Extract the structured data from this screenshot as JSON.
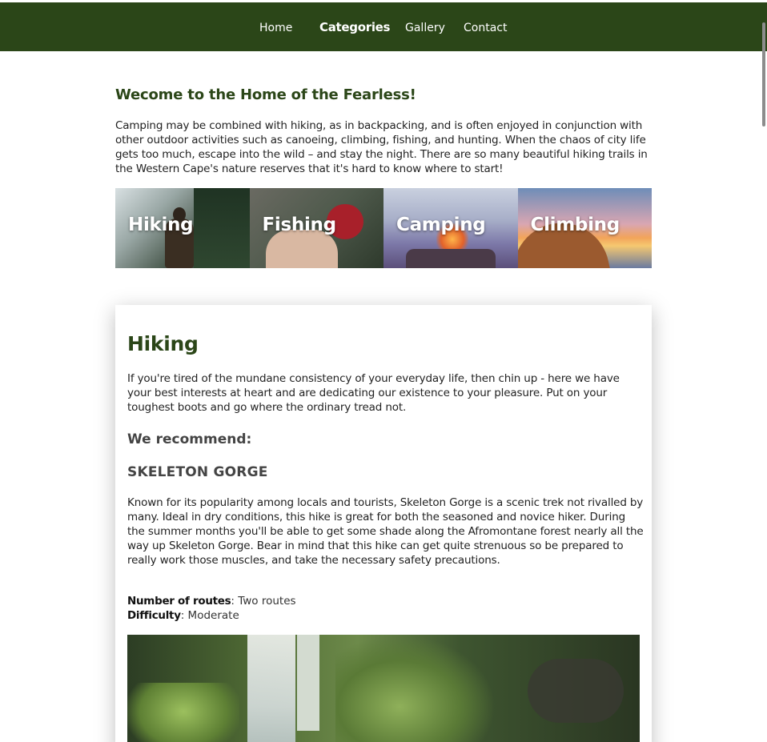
{
  "nav": {
    "items": [
      {
        "label": "Home"
      },
      {
        "label": "Categories"
      },
      {
        "label": "Gallery"
      },
      {
        "label": "Contact"
      }
    ],
    "active": "Categories"
  },
  "welcome": {
    "title": "Wecome to the Home of the Fearless!",
    "text": "Camping may be combined with hiking, as in backpacking, and is often enjoyed in conjunction with other outdoor activities such as canoeing, climbing, fishing, and hunting. When the chaos of city life gets too much, escape into the wild – and stay the night. There are so many beautiful hiking trails in the Western Cape's nature reserves that it's hard to know where to start!"
  },
  "categories": [
    {
      "label": "Hiking"
    },
    {
      "label": "Fishing"
    },
    {
      "label": "Camping"
    },
    {
      "label": "Climbing"
    }
  ],
  "section": {
    "title": "Hiking",
    "intro": "If you're tired of the mundane consistency of your everyday life, then chin up - here we have your best interests at heart and are dedicating our existence to your pleasure. Put on your toughest boots and go where the ordinary tread not.",
    "recommend_heading": "We recommend:",
    "trail": {
      "name": "SKELETON GORGE",
      "description": "Known for its popularity among locals and tourists, Skeleton Gorge is a scenic trek not rivalled by many. Ideal in dry conditions, this hike is great for both the seasoned and novice hiker. During the summer months you'll be able to get some shade along the Afromontane forest nearly all the way up Skeleton Gorge. Bear in mind that this hike can get quite strenuous so be prepared to really work those muscles, and take the necessary safety precautions.",
      "routes_label": "Number of routes",
      "routes_value": ": Two routes",
      "difficulty_label": "Difficulty",
      "difficulty_value": ": Moderate"
    }
  },
  "colors": {
    "nav_bg": "#2b4618",
    "heading": "#2b4618"
  }
}
